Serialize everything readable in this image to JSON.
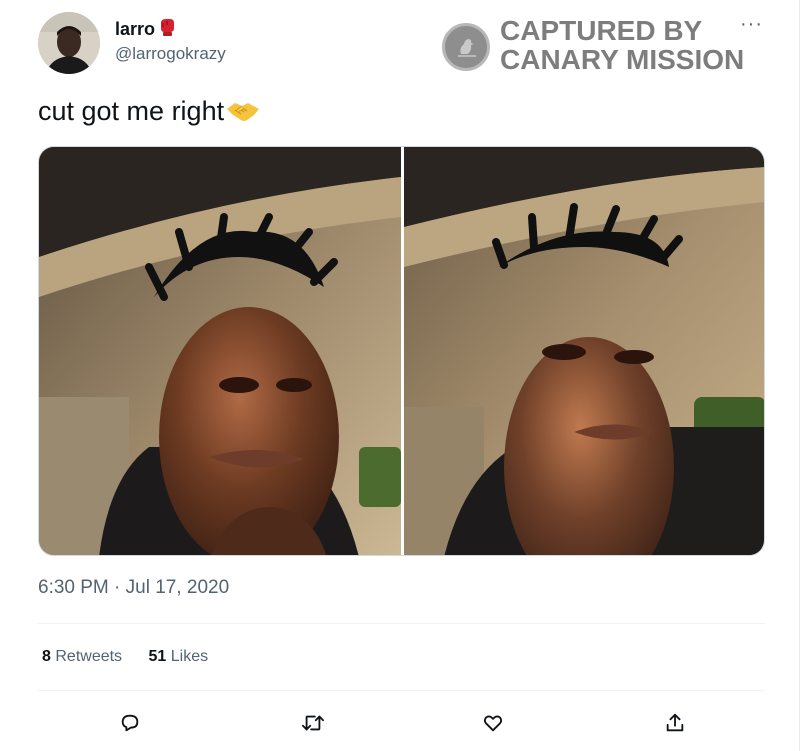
{
  "user": {
    "display_name": "larro",
    "name_emoji": "boxing-glove",
    "handle": "@larrogokrazy"
  },
  "watermark": {
    "line1": "CAPTURED BY",
    "line2": "CANARY MISSION"
  },
  "tweet": {
    "text": "cut got me right",
    "emoji": "handshake",
    "timestamp": "6:30 PM · Jul 17, 2020"
  },
  "stats": {
    "retweets_count": "8",
    "retweets_label": "Retweets",
    "likes_count": "51",
    "likes_label": "Likes"
  },
  "actions": [
    "reply-icon",
    "retweet-icon",
    "like-icon",
    "share-icon"
  ],
  "colors": {
    "text_primary": "#0f1419",
    "text_secondary": "#536471",
    "divider": "#eff3f4",
    "watermark": "#7d7d7d"
  }
}
